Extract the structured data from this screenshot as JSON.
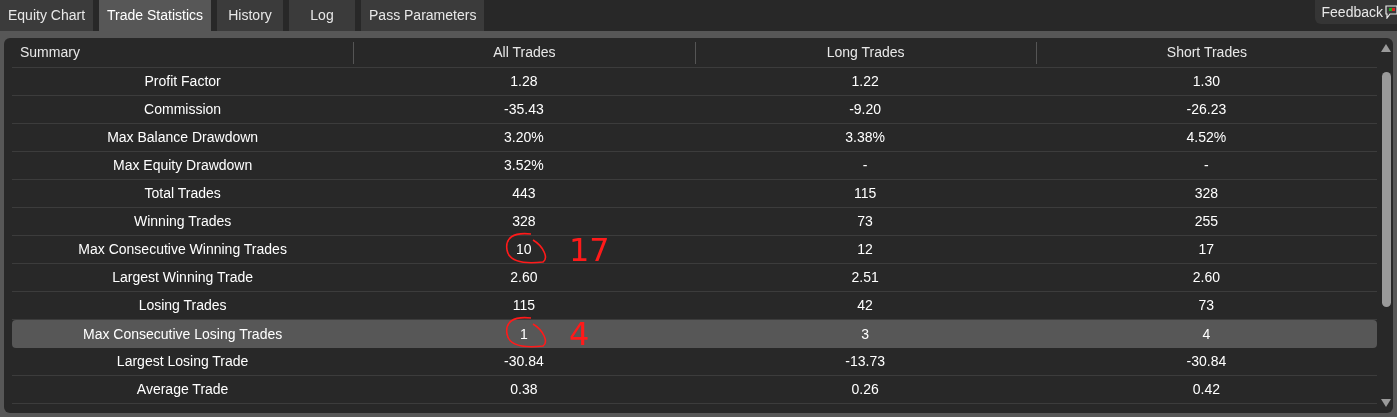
{
  "tabs": [
    {
      "label": "Equity Chart",
      "selected": false
    },
    {
      "label": "Trade Statistics",
      "selected": true
    },
    {
      "label": "History",
      "selected": false
    },
    {
      "label": "Log",
      "selected": false
    },
    {
      "label": "Pass Parameters",
      "selected": false
    }
  ],
  "feedback": {
    "label": "Feedback"
  },
  "table": {
    "columns": [
      "Summary",
      "All Trades",
      "Long Trades",
      "Short Trades"
    ],
    "rows": [
      {
        "cells": [
          "Profit Factor",
          "1.28",
          "1.22",
          "1.30"
        ],
        "selected": false
      },
      {
        "cells": [
          "Commission",
          "-35.43",
          "-9.20",
          "-26.23"
        ],
        "selected": false
      },
      {
        "cells": [
          "Max Balance Drawdown",
          "3.20%",
          "3.38%",
          "4.52%"
        ],
        "selected": false
      },
      {
        "cells": [
          "Max Equity Drawdown",
          "3.52%",
          "-",
          "-"
        ],
        "selected": false
      },
      {
        "cells": [
          "Total Trades",
          "443",
          "115",
          "328"
        ],
        "selected": false
      },
      {
        "cells": [
          "Winning Trades",
          "328",
          "73",
          "255"
        ],
        "selected": false
      },
      {
        "cells": [
          "Max Consecutive Winning Trades",
          "10",
          "12",
          "17"
        ],
        "selected": false,
        "annotation": {
          "note": "17"
        }
      },
      {
        "cells": [
          "Largest Winning Trade",
          "2.60",
          "2.51",
          "2.60"
        ],
        "selected": false
      },
      {
        "cells": [
          "Losing Trades",
          "115",
          "42",
          "73"
        ],
        "selected": false
      },
      {
        "cells": [
          "Max Consecutive Losing Trades",
          "1",
          "3",
          "4"
        ],
        "selected": true,
        "annotation": {
          "note": "4"
        }
      },
      {
        "cells": [
          "Largest Losing Trade",
          "-30.84",
          "-13.73",
          "-30.84"
        ],
        "selected": false
      },
      {
        "cells": [
          "Average Trade",
          "0.38",
          "0.26",
          "0.42"
        ],
        "selected": false
      }
    ]
  }
}
